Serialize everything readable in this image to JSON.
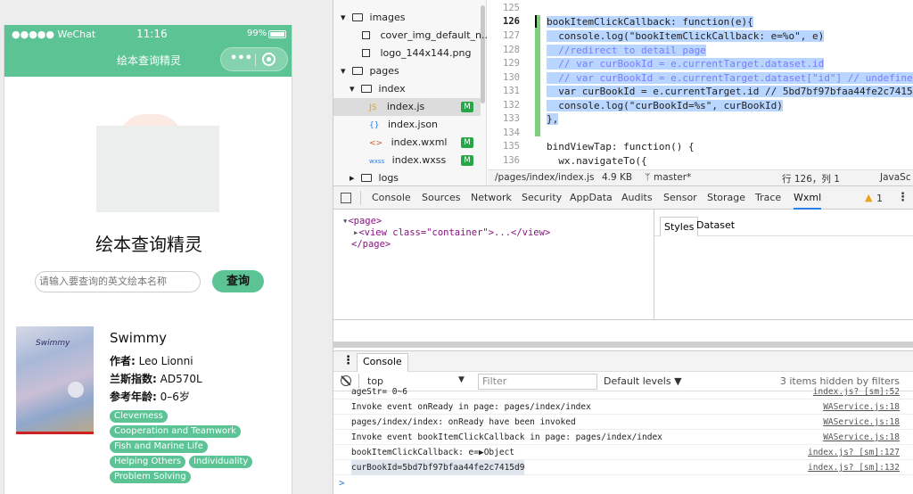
{
  "phone": {
    "status": {
      "carrier": "●●●●● WeChat",
      "time": "11:16",
      "battery": "99%"
    },
    "nav_title": "绘本查询精灵",
    "capsule_more": "•••",
    "app_title": "绘本查询精灵",
    "search": {
      "placeholder": "请输入要查询的英文绘本名称",
      "button": "查询"
    },
    "book": {
      "title": "Swimmy",
      "author_label": "作者:",
      "author": "Leo Lionni",
      "lexile_label": "兰斯指数:",
      "lexile": "AD570L",
      "age_label": "参考年龄:",
      "age": "0–6岁",
      "cover_text": "Swimmy",
      "tags": [
        "Cleverness",
        "Cooperation and Teamwork",
        "Fish and Marine Life",
        "Helping Others",
        "Individuality",
        "Problem Solving"
      ]
    }
  },
  "tree": {
    "items": [
      {
        "label": "images",
        "kind": "folder-open"
      },
      {
        "label": "cover_img_default_n...",
        "kind": "image"
      },
      {
        "label": "logo_144x144.png",
        "kind": "image"
      },
      {
        "label": "pages",
        "kind": "folder-open"
      },
      {
        "label": "index",
        "kind": "folder-open"
      },
      {
        "label": "index.js",
        "kind": "js",
        "badge": "M"
      },
      {
        "label": "index.json",
        "kind": "json"
      },
      {
        "label": "index.wxml",
        "kind": "wxml",
        "badge": "M"
      },
      {
        "label": "index.wxss",
        "kind": "wxss",
        "badge": "M"
      },
      {
        "label": "logs",
        "kind": "folder-closed"
      }
    ]
  },
  "editor": {
    "line_numbers": [
      "125",
      "126",
      "127",
      "128",
      "129",
      "130",
      "131",
      "132",
      "133",
      "134",
      "135",
      "136"
    ],
    "lines": [
      "",
      "bookItemClickCallback: function(e){",
      "  console.log(\"bookItemClickCallback: e=%o\", e)",
      "  //redirect to detail page",
      "  // var curBookId = e.currentTarget.dataset.id",
      "  // var curBookId = e.currentTarget.dataset[\"id\"] // undefined",
      "  var curBookId = e.currentTarget.id // 5bd7bf97bfaa44fe2c7415d9",
      "  console.log(\"curBookId=%s\", curBookId)",
      "},",
      "",
      "bindViewTap: function() {",
      "  wx.navigateTo({"
    ],
    "file_path": "/pages/index/index.js",
    "file_size": "4.9 KB",
    "branch": "master*",
    "position": "行 126，列 1",
    "language": "JavaSc"
  },
  "devtools_tabs": [
    "Console",
    "Sources",
    "Network",
    "Security",
    "AppData",
    "Audits",
    "Sensor",
    "Storage",
    "Trace",
    "Wxml"
  ],
  "warnings": "1",
  "wxml": {
    "lines": [
      "<page>",
      "<view class=\"container\">...</view>",
      "</page>"
    ]
  },
  "styles_tabs": [
    "Styles",
    "Dataset"
  ],
  "console": {
    "tab": "Console",
    "context": "top",
    "filter_placeholder": "Filter",
    "levels": "Default levels ▼",
    "hidden": "3 items hidden by filters",
    "logs": [
      {
        "msg": "ageStr= 0~6",
        "src": "index.js? [sm]:52"
      },
      {
        "msg": "Invoke event onReady in page: pages/index/index",
        "src": "WAService.js:18"
      },
      {
        "msg": "pages/index/index: onReady have been invoked",
        "src": "WAService.js:18"
      },
      {
        "msg": "Invoke event bookItemClickCallback in page: pages/index/index",
        "src": "WAService.js:18"
      },
      {
        "msg": "bookItemClickCallback: e=▶Object",
        "src": "index.js? [sm]:127"
      },
      {
        "msg": "curBookId=5bd7bf97bfaa44fe2c7415d9",
        "src": "index.js? [sm]:132"
      }
    ],
    "prompt": ">"
  }
}
